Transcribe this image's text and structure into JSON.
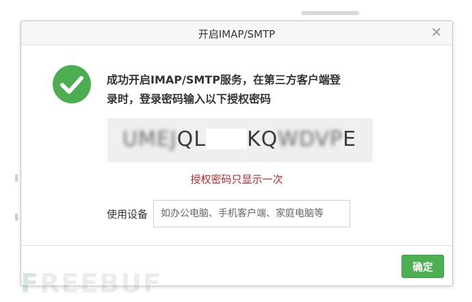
{
  "dialog": {
    "title": "开启IMAP/SMTP",
    "close_glyph": "✕",
    "message_line1": "成功开启IMAP/SMTP服务，在第三方客户端登",
    "message_line2": "录时，登录密码输入以下授权密码",
    "auth_code": {
      "blurred_prefix": "UMEJ",
      "visible_part1": "QL",
      "visible_part2": "KQ",
      "blurred_suffix": "WDVP",
      "visible_end": "E"
    },
    "warning": "授权密码只显示一次",
    "device_label": "使用设备",
    "device_placeholder": "如办公电脑、手机客户端、家庭电脑等",
    "device_value": "",
    "confirm_label": "确定"
  },
  "watermark": {
    "first": "F",
    "rest": "REEBUF"
  },
  "colors": {
    "success_green": "#4cae50",
    "warning_red": "#c0282d",
    "button_green": "#4cb052"
  },
  "icons": {
    "success": "check-circle-icon",
    "close": "close-icon"
  }
}
